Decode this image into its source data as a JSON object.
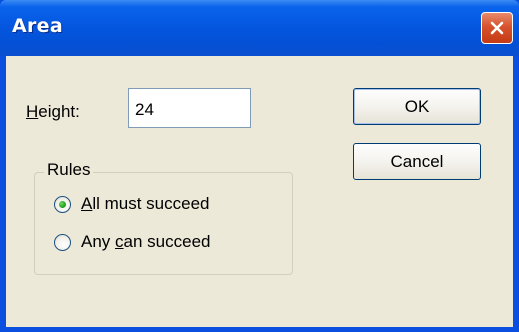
{
  "window": {
    "title": "Area"
  },
  "form": {
    "height_label_mnemonic": "H",
    "height_label_rest": "eight:",
    "height_value": "24"
  },
  "buttons": {
    "ok_label": "OK",
    "cancel_label": "Cancel"
  },
  "rules": {
    "group_label": "Rules",
    "options": [
      {
        "mnemonic": "A",
        "rest": "ll must succeed",
        "selected": true
      },
      {
        "prefix": "Any ",
        "mnemonic": "c",
        "rest": "an succeed",
        "selected": false
      }
    ]
  },
  "icons": {
    "close": "close-icon"
  },
  "colors": {
    "titlebar": "#0557e0",
    "dialog_bg": "#ece9d8",
    "close_button": "#d7532d",
    "radio_selected": "#23a31c"
  }
}
